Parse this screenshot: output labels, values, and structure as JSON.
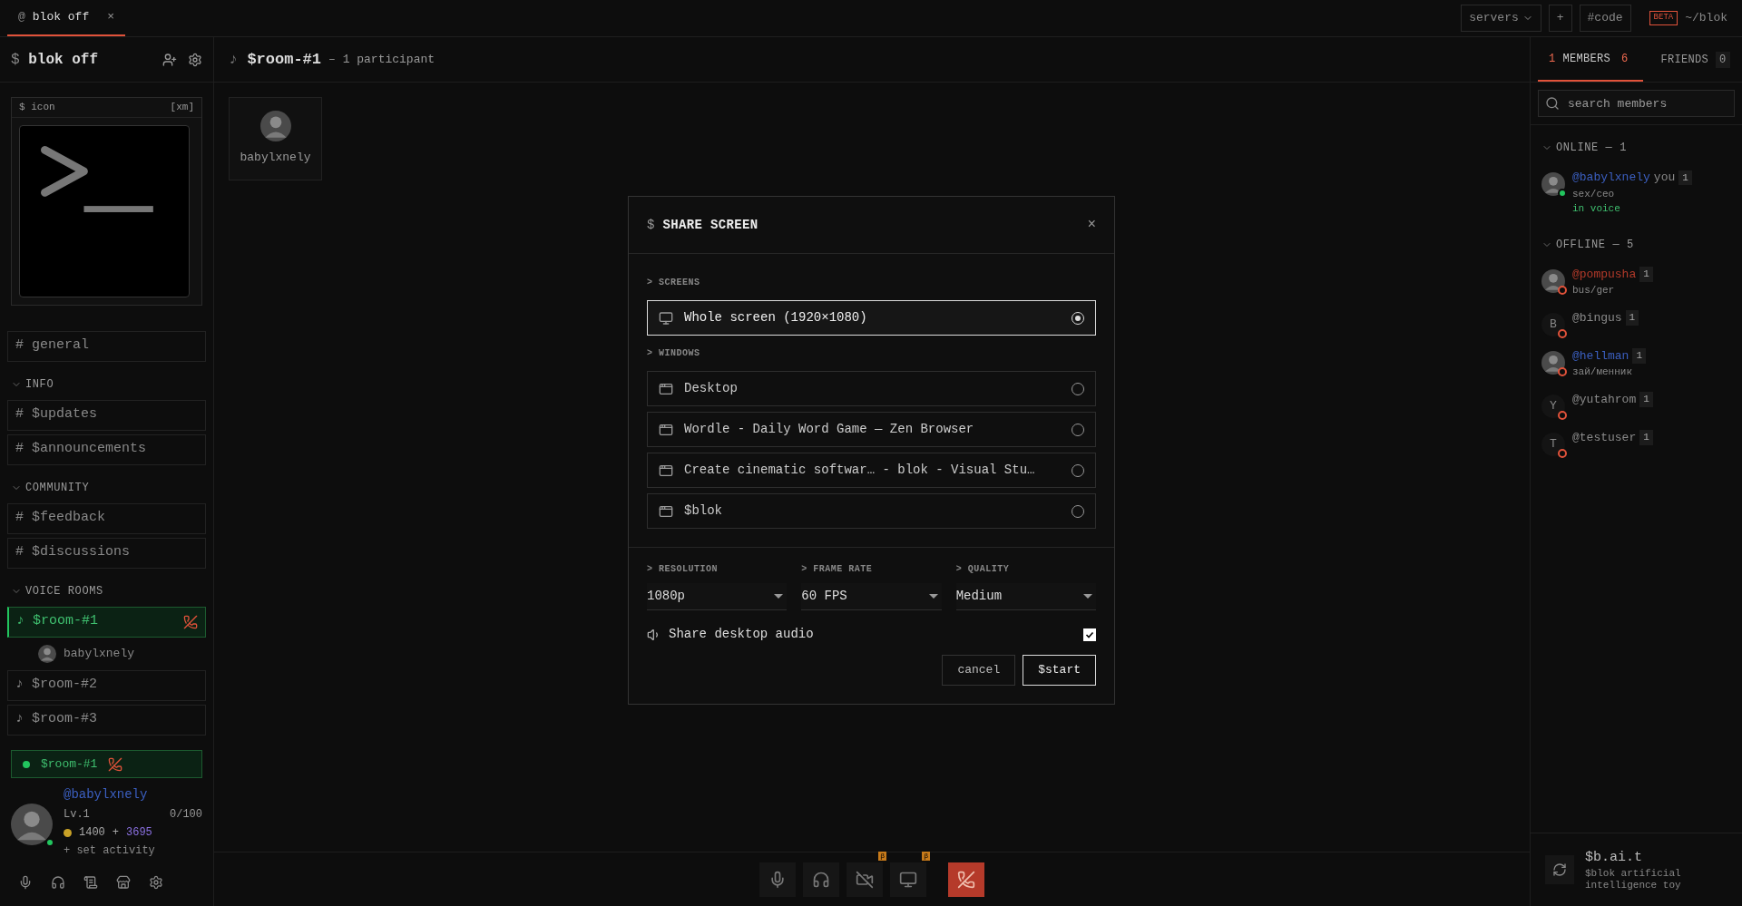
{
  "top_bar": {
    "tab": {
      "icon": "@",
      "label": "blok off",
      "close": "×",
      "selected": true
    },
    "servers": "servers",
    "plus": "+",
    "code": "#code",
    "beta": "BETA",
    "path": "~/blok"
  },
  "server": {
    "prefix": "$",
    "name": "blok off",
    "icon_card": {
      "label": "$ icon",
      "tag": "[xm]"
    }
  },
  "channels": [
    {
      "kind": "text",
      "symbol": "#",
      "name": "general",
      "selected": false
    },
    {
      "kind": "header",
      "name": "INFO"
    },
    {
      "kind": "text",
      "symbol": "#",
      "name": "$updates",
      "selected": false
    },
    {
      "kind": "text",
      "symbol": "#",
      "name": "$announcements",
      "selected": false
    },
    {
      "kind": "header",
      "name": "COMMUNITY"
    },
    {
      "kind": "text",
      "symbol": "#",
      "name": "$feedback",
      "selected": false
    },
    {
      "kind": "text",
      "symbol": "#",
      "name": "$discussions",
      "selected": false
    },
    {
      "kind": "header",
      "name": "VOICE ROOMS"
    },
    {
      "kind": "voice",
      "symbol": "♪",
      "name": "$room-#1",
      "selected": true,
      "members": [
        "babylxnely"
      ]
    },
    {
      "kind": "voice",
      "symbol": "♪",
      "name": "$room-#2",
      "selected": false
    },
    {
      "kind": "voice",
      "symbol": "♪",
      "name": "$room-#3",
      "selected": false
    }
  ],
  "voice_status": {
    "room": "$room-#1"
  },
  "user": {
    "handle": "@babylxnely",
    "level": "Lv.1",
    "xp": "0/100",
    "coins": "1400",
    "plus": "+",
    "gems": "3695",
    "activity": "+ set activity"
  },
  "room": {
    "symbol": "♪",
    "name": "$room-#1",
    "participants": "– 1 participant",
    "tiles": [
      "babylxnely"
    ]
  },
  "call_controls": [
    {
      "kind": "mic"
    },
    {
      "kind": "headphones"
    },
    {
      "kind": "camera-off",
      "badge": "β"
    },
    {
      "kind": "screen",
      "badge": "β"
    },
    {
      "kind": "hangup"
    }
  ],
  "members_panel": {
    "tabs": [
      {
        "icon": "1",
        "label": "MEMBERS",
        "count": "6",
        "selected": true
      },
      {
        "label": "FRIENDS",
        "count": "0",
        "selected": false
      }
    ],
    "search": {
      "placeholder": "search members"
    },
    "groups": [
      {
        "title": "ONLINE — 1",
        "members": [
          {
            "handle": "@babylxnely",
            "you": "you",
            "level": "1",
            "status": "sex/ceo",
            "activity": "in voice",
            "online": true,
            "color": "#3b5fc0"
          }
        ]
      },
      {
        "title": "OFFLINE — 5",
        "members": [
          {
            "handle": "@pompusha",
            "level": "1",
            "status": "bus/ger",
            "online": false,
            "color": "#b33a2a"
          },
          {
            "initial": "B",
            "handle": "@bingus",
            "level": "1",
            "online": false,
            "color": "#8a8a8a"
          },
          {
            "handle": "@hellman",
            "level": "1",
            "status": "зай/менник",
            "online": false,
            "color": "#3b5fc0"
          },
          {
            "initial": "Y",
            "handle": "@yutahrom",
            "level": "1",
            "online": false,
            "color": "#8a8a8a"
          },
          {
            "initial": "T",
            "handle": "@testuser",
            "level": "1",
            "online": false,
            "color": "#8a8a8a"
          }
        ]
      }
    ],
    "bot": {
      "name": "$b.ai.t",
      "description": "$blok artificial intelligence toy"
    }
  },
  "dialog": {
    "prefix": "$",
    "title": "SHARE SCREEN",
    "close": "×",
    "sections": [
      {
        "title": "> SCREENS",
        "options": [
          {
            "kind": "screen",
            "label": "Whole screen (1920×1080)",
            "selected": true
          }
        ]
      },
      {
        "title": "> WINDOWS",
        "options": [
          {
            "kind": "window",
            "label": "Desktop",
            "selected": false
          },
          {
            "kind": "window",
            "label": "Wordle - Daily Word Game — Zen Browser",
            "selected": false
          },
          {
            "kind": "window",
            "label": "Create cinematic softwar… - blok - Visual Stu…",
            "selected": false
          },
          {
            "kind": "window",
            "label": "$blok",
            "selected": false
          }
        ]
      }
    ],
    "settings": [
      {
        "label": "> RESOLUTION",
        "value": "1080p"
      },
      {
        "label": "> FRAME RATE",
        "value": "60 FPS"
      },
      {
        "label": "> QUALITY",
        "value": "Medium"
      }
    ],
    "audio": {
      "label": "Share desktop audio",
      "checked": true
    },
    "buttons": [
      {
        "kind": "secondary",
        "label": "cancel"
      },
      {
        "kind": "primary",
        "label": "$start"
      }
    ]
  }
}
